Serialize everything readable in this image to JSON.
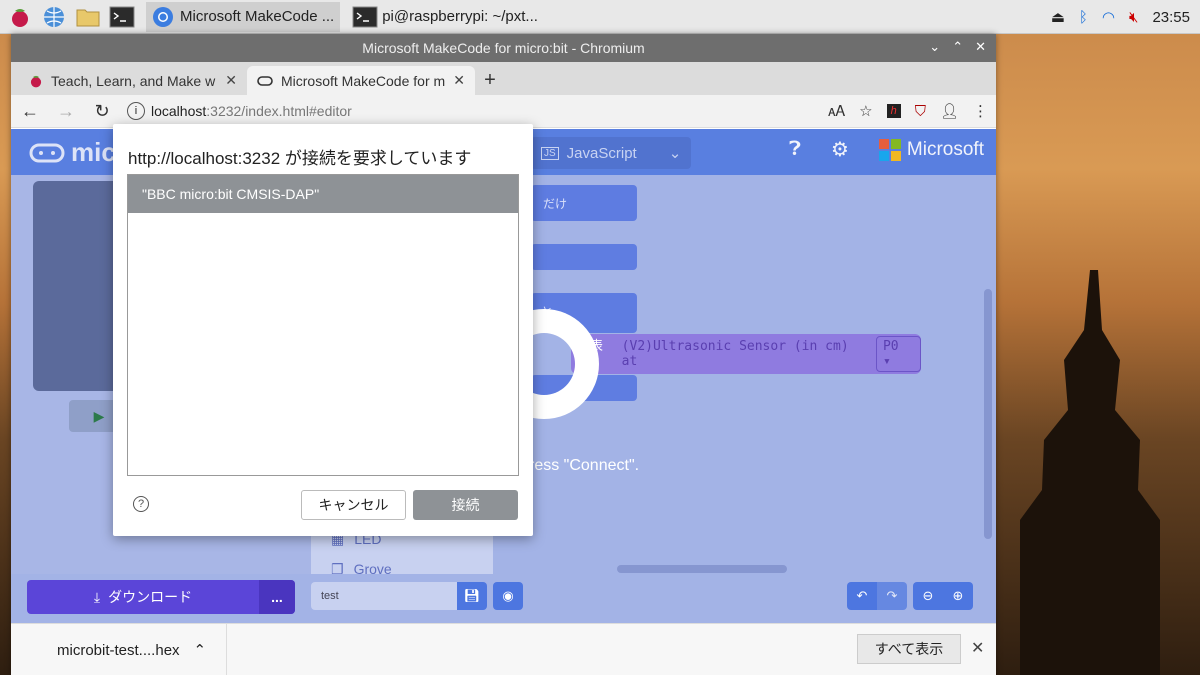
{
  "taskbar": {
    "tasks": [
      {
        "label": "Microsoft MakeCode ..."
      },
      {
        "label": "pi@raspberrypi: ~/pxt..."
      }
    ],
    "clock": "23:55"
  },
  "window": {
    "title": "Microsoft MakeCode for micro:bit - Chromium",
    "tabs": [
      {
        "label": "Teach, Learn, and Make w"
      },
      {
        "label": "Microsoft MakeCode for m"
      }
    ],
    "url_host": "localhost",
    "url_path": ":3232/index.html#editor"
  },
  "makecode": {
    "logo_text": "micro",
    "lang_label": "JavaScript",
    "ms_label": "Microsoft",
    "blocks": {
      "b1": "だけ",
      "b3": "と",
      "sensor_prefix": "を表示",
      "sensor_text": "(V2)Ultrasonic Sensor (in cm) at",
      "pin": "P0"
    },
    "hint": "ress \"Connect\".",
    "toolbox": [
      {
        "label": "LED"
      },
      {
        "label": "Grove"
      }
    ],
    "download_label": "ダウンロード",
    "more_label": "...",
    "project_name": "test"
  },
  "dialog": {
    "title": "http://localhost:3232 が接続を要求しています",
    "devices": [
      {
        "label": "\"BBC micro:bit CMSIS-DAP\""
      }
    ],
    "cancel_label": "キャンセル",
    "connect_label": "接続"
  },
  "shelf": {
    "file_label": "microbit-test....hex",
    "show_all_label": "すべて表示"
  }
}
